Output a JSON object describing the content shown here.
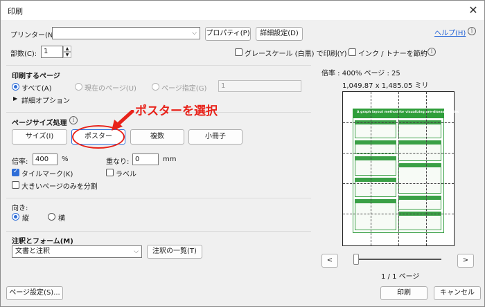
{
  "window": {
    "title": "印刷",
    "close_glyph": "✕"
  },
  "printer": {
    "label": "プリンター(N):",
    "value": "",
    "properties_btn": "プロパティ(P)",
    "advanced_btn": "詳細設定(D)",
    "help_link": "ヘルプ(H)"
  },
  "copies": {
    "label": "部数(C):",
    "value": "1"
  },
  "options": {
    "grayscale": "グレースケール (白黒) で印刷(Y)",
    "save_ink": "インク / トナーを節約"
  },
  "print_range": {
    "heading": "印刷するページ",
    "all": "すべて(A)",
    "current": "現在のページ(U)",
    "pages": "ページ指定(G)",
    "pages_value": "1",
    "more_options": "詳細オプション"
  },
  "page_sizing": {
    "heading": "ページサイズ処理",
    "tabs": [
      "サイズ(I)",
      "ポスター",
      "複数",
      "小冊子"
    ],
    "scale_label": "倍率:",
    "scale_value": "400",
    "scale_unit": "%",
    "overlap_label": "重なり:",
    "overlap_value": "0",
    "overlap_unit": "mm",
    "tile_marks": "タイルマーク(K)",
    "labels": "ラベル",
    "large_pages_only": "大きいページのみを分割"
  },
  "annotation": {
    "text": "ポスターを選択"
  },
  "orientation": {
    "heading": "向き:",
    "portrait": "縦",
    "landscape": "横"
  },
  "comments_forms": {
    "heading": "注釈とフォーム(M)",
    "value": "文書と注釈",
    "summary_btn": "注釈の一覧(T)"
  },
  "preview": {
    "scale_text": "倍率 : 400% ページ : 25",
    "dimensions": "1,049.87 x 1,485.05 ミリ",
    "page_counter": "1 / 1 ページ",
    "prev": "<",
    "next": ">",
    "poster_title": "A graph layout method for visualizing pre-disease states"
  },
  "footer": {
    "page_setup": "ページ設定(S)...",
    "print": "印刷",
    "cancel": "キャンセル"
  },
  "colors": {
    "accent": "#2f6ed8",
    "annotation_red": "#e8231b",
    "poster_green": "#2e9e3a"
  }
}
